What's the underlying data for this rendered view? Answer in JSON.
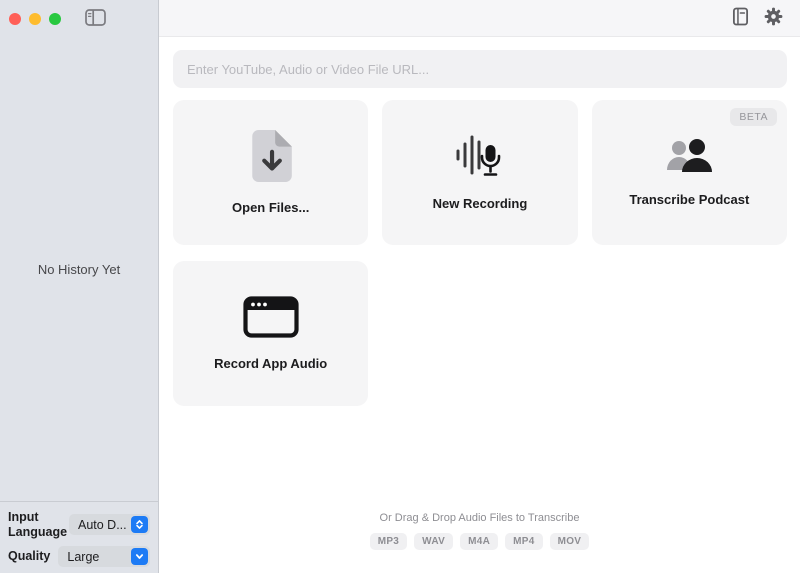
{
  "window_controls": {
    "close": "red",
    "minimize": "yellow",
    "zoom": "green"
  },
  "toolbar": {
    "icons": [
      "sidebar-toggle-icon",
      "transcript-library-icon",
      "settings-gear-icon"
    ]
  },
  "sidebar": {
    "empty_state": "No History Yet",
    "controls": {
      "input_language": {
        "label": "Input Language",
        "value": "Auto D..."
      },
      "quality": {
        "label": "Quality",
        "value": "Large"
      }
    }
  },
  "url_input": {
    "placeholder": "Enter YouTube, Audio or Video File URL..."
  },
  "cards": [
    {
      "label": "Open Files...",
      "icon": "file-download-icon"
    },
    {
      "label": "New Recording",
      "icon": "waveform-microphone-icon"
    },
    {
      "label": "Transcribe Podcast",
      "icon": "people-icon",
      "badge": "BETA"
    },
    {
      "label": "Record App Audio",
      "icon": "app-window-icon"
    }
  ],
  "dropzone": {
    "hint": "Or Drag & Drop Audio Files to Transcribe",
    "formats": [
      "MP3",
      "WAV",
      "M4A",
      "MP4",
      "MOV"
    ]
  },
  "colors": {
    "accent_blue": "#1d7bf5",
    "sidebar_bg": "#e0e3e9",
    "card_bg": "#f5f5f6",
    "traffic_red": "#ff5f57",
    "traffic_yellow": "#febc2e",
    "traffic_green": "#28c840"
  }
}
